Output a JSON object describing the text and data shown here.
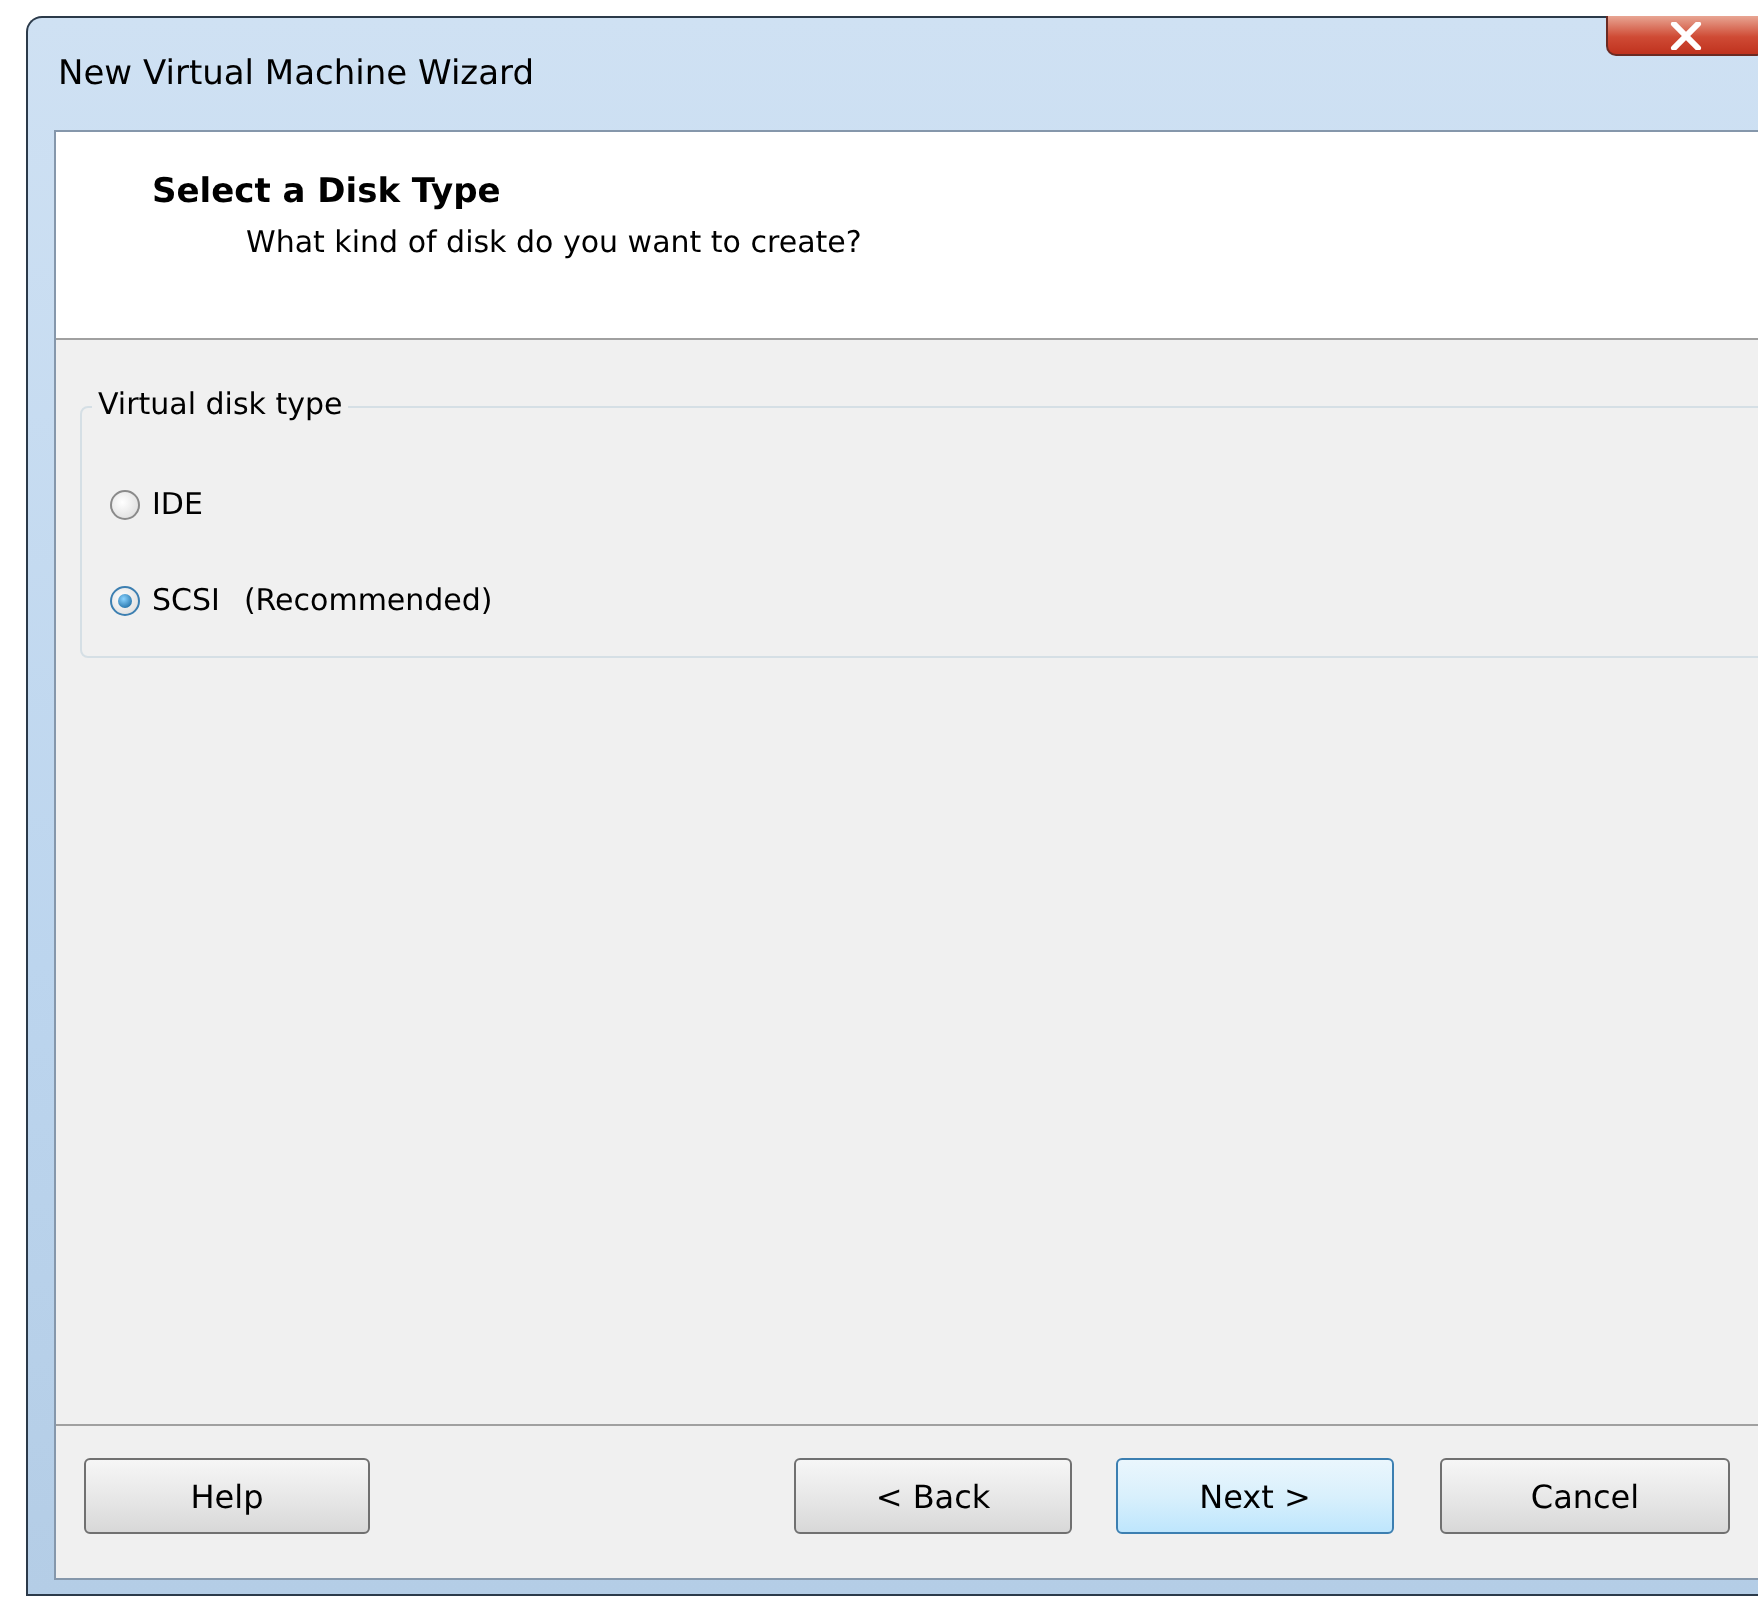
{
  "window": {
    "title": "New Virtual Machine Wizard"
  },
  "header": {
    "title": "Select a Disk Type",
    "subtitle": "What kind of disk do you want to create?"
  },
  "group": {
    "label": "Virtual disk type",
    "options": [
      {
        "label": "IDE",
        "selected": false
      },
      {
        "label": "SCSI",
        "note": "(Recommended)",
        "selected": true
      }
    ]
  },
  "buttons": [
    {
      "label": "Help",
      "default": false
    },
    {
      "label": "< Back",
      "default": false
    },
    {
      "label": "Next >",
      "default": true
    },
    {
      "label": "Cancel",
      "default": false
    }
  ]
}
